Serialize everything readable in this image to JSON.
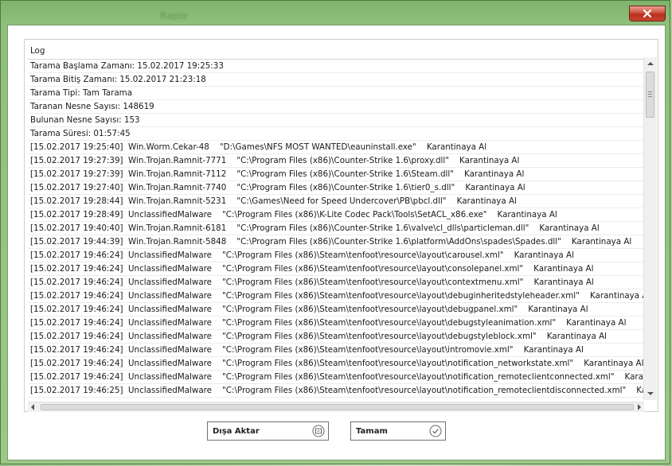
{
  "window": {
    "title": "Rapor"
  },
  "log": {
    "header": "Log",
    "summary": [
      "Tarama Başlama Zamanı: 15.02.2017 19:25:33",
      "Tarama Bitiş Zamanı: 15.02.2017 21:23:18",
      "Tarama Tipi: Tam Tarama",
      "Taranan Nesne Sayısı: 148619",
      "Bulunan Nesne Sayısı: 153",
      "Tarama Süresi: 01:57:45"
    ],
    "entries": [
      {
        "time": "[15.02.2017 19:25:40]",
        "detail": "Win.Worm.Cekar-48    \"D:\\Games\\NFS MOST WANTED\\eauninstall.exe\"    Karantinaya Al"
      },
      {
        "time": "[15.02.2017 19:27:39]",
        "detail": "Win.Trojan.Ramnit-7771    \"C:\\Program Files (x86)\\Counter-Strike 1.6\\proxy.dll\"    Karantinaya Al"
      },
      {
        "time": "[15.02.2017 19:27:39]",
        "detail": "Win.Trojan.Ramnit-7112    \"C:\\Program Files (x86)\\Counter-Strike 1.6\\Steam.dll\"    Karantinaya Al"
      },
      {
        "time": "[15.02.2017 19:27:40]",
        "detail": "Win.Trojan.Ramnit-7740    \"C:\\Program Files (x86)\\Counter-Strike 1.6\\tier0_s.dll\"    Karantinaya Al"
      },
      {
        "time": "[15.02.2017 19:28:44]",
        "detail": "Win.Trojan.Ramnit-5231    \"C:\\Games\\Need for Speed Undercover\\PB\\pbcl.dll\"    Karantinaya Al"
      },
      {
        "time": "[15.02.2017 19:28:49]",
        "detail": "UnclassifiedMalware    \"C:\\Program Files (x86)\\K-Lite Codec Pack\\Tools\\SetACL_x86.exe\"    Karantinaya Al"
      },
      {
        "time": "[15.02.2017 19:40:40]",
        "detail": "Win.Trojan.Ramnit-6181    \"C:\\Program Files (x86)\\Counter-Strike 1.6\\valve\\cl_dlls\\particleman.dll\"    Karantinaya Al"
      },
      {
        "time": "[15.02.2017 19:44:39]",
        "detail": "Win.Trojan.Ramnit-5848    \"C:\\Program Files (x86)\\Counter-Strike 1.6\\platform\\AddOns\\spades\\Spades.dll\"    Karantinaya Al"
      },
      {
        "time": "[15.02.2017 19:46:24]",
        "detail": "UnclassifiedMalware    \"C:\\Program Files (x86)\\Steam\\tenfoot\\resource\\layout\\carousel.xml\"    Karantinaya Al"
      },
      {
        "time": "[15.02.2017 19:46:24]",
        "detail": "UnclassifiedMalware    \"C:\\Program Files (x86)\\Steam\\tenfoot\\resource\\layout\\consolepanel.xml\"    Karantinaya Al"
      },
      {
        "time": "[15.02.2017 19:46:24]",
        "detail": "UnclassifiedMalware    \"C:\\Program Files (x86)\\Steam\\tenfoot\\resource\\layout\\contextmenu.xml\"    Karantinaya Al"
      },
      {
        "time": "[15.02.2017 19:46:24]",
        "detail": "UnclassifiedMalware    \"C:\\Program Files (x86)\\Steam\\tenfoot\\resource\\layout\\debuginheritedstyleheader.xml\"    Karantinaya Al"
      },
      {
        "time": "[15.02.2017 19:46:24]",
        "detail": "UnclassifiedMalware    \"C:\\Program Files (x86)\\Steam\\tenfoot\\resource\\layout\\debugpanel.xml\"    Karantinaya Al"
      },
      {
        "time": "[15.02.2017 19:46:24]",
        "detail": "UnclassifiedMalware    \"C:\\Program Files (x86)\\Steam\\tenfoot\\resource\\layout\\debugstyleanimation.xml\"    Karantinaya Al"
      },
      {
        "time": "[15.02.2017 19:46:24]",
        "detail": "UnclassifiedMalware    \"C:\\Program Files (x86)\\Steam\\tenfoot\\resource\\layout\\debugstyleblock.xml\"    Karantinaya Al"
      },
      {
        "time": "[15.02.2017 19:46:24]",
        "detail": "UnclassifiedMalware    \"C:\\Program Files (x86)\\Steam\\tenfoot\\resource\\layout\\intromovie.xml\"    Karantinaya Al"
      },
      {
        "time": "[15.02.2017 19:46:24]",
        "detail": "UnclassifiedMalware    \"C:\\Program Files (x86)\\Steam\\tenfoot\\resource\\layout\\notification_networkstate.xml\"    Karantinaya Al"
      },
      {
        "time": "[15.02.2017 19:46:24]",
        "detail": "UnclassifiedMalware    \"C:\\Program Files (x86)\\Steam\\tenfoot\\resource\\layout\\notification_remoteclientconnected.xml\"    Karantinaya Al"
      },
      {
        "time": "[15.02.2017 19:46:25]",
        "detail": "UnclassifiedMalware    \"C:\\Program Files (x86)\\Steam\\tenfoot\\resource\\layout\\notification_remoteclientdisconnected.xml\"    Karantinaya Al"
      }
    ]
  },
  "buttons": {
    "export_label": "Dışa Aktar",
    "export_icon": "export-icon",
    "ok_label": "Tamam",
    "ok_icon": "checkmark-circle-icon"
  },
  "colors": {
    "close": "#c7452f",
    "frame": "#8fc07a"
  }
}
